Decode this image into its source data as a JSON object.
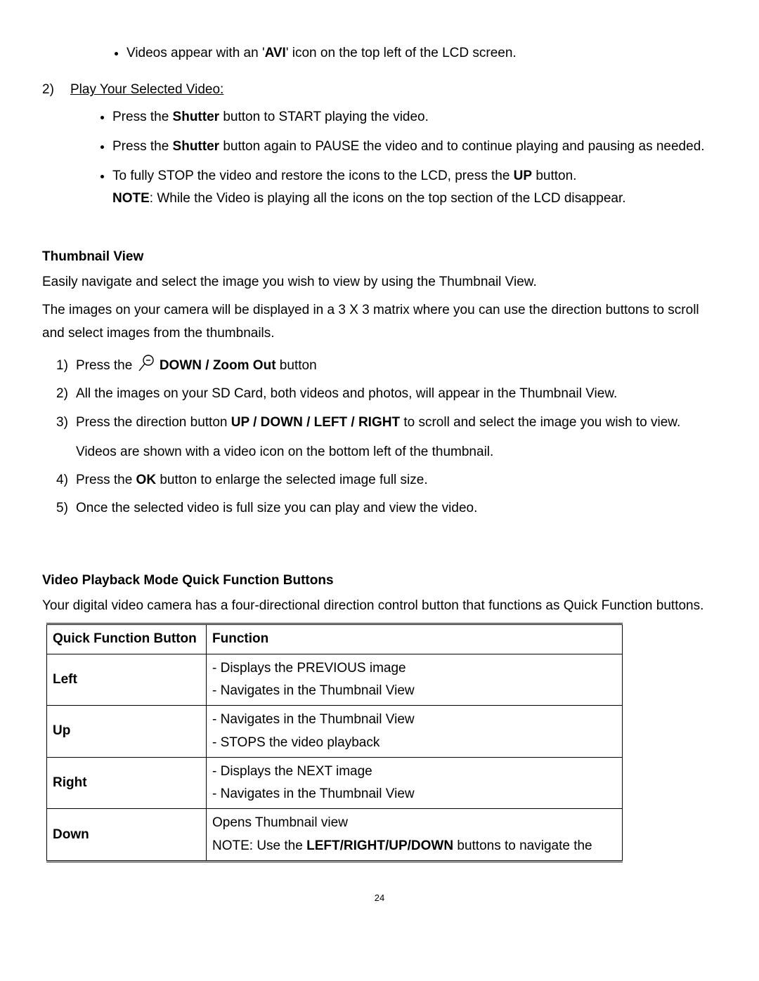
{
  "top_bullet": {
    "pre": "Videos appear with an '",
    "avi": "AVI",
    "post": "' icon on the top left of the LCD screen."
  },
  "play_heading_num": "2)",
  "play_heading": "Play Your Selected Video:",
  "play_bullets": {
    "b1_pre": "Press the ",
    "b1_bold": "Shutter",
    "b1_post": " button to START playing the video.",
    "b2_pre": "Press the ",
    "b2_bold": "Shutter",
    "b2_post": " button again to PAUSE the video and to continue playing and pausing as needed.",
    "b3_pre": "To fully STOP the video and restore the icons to the LCD, press the ",
    "b3_bold": "UP",
    "b3_post": " button.",
    "b3_note_label": "NOTE",
    "b3_note_rest": ": While the Video is playing all the icons on the top section of the LCD disappear."
  },
  "thumb_heading": "Thumbnail View",
  "thumb_p1": "Easily navigate and select the image you wish to view by using the Thumbnail View.",
  "thumb_p2": "The images on your camera will be displayed in a 3 X 3 matrix where you can use the direction buttons to scroll and select images from the thumbnails.",
  "thumb_steps": {
    "s1_num": "1)",
    "s1_pre": "Press the ",
    "s1_bold": "DOWN / Zoom Out",
    "s1_post": " button",
    "s2_num": "2)",
    "s2": "All the images on your SD Card, both videos and photos, will appear in the Thumbnail View.",
    "s3_num": "3)",
    "s3_pre": "Press the direction button ",
    "s3_bold": "UP / DOWN / LEFT / RIGHT",
    "s3_post": " to scroll and select the image you wish to view.",
    "s3_sub": "Videos are shown with a video icon on the bottom left of the thumbnail.",
    "s4_num": "4)",
    "s4_pre": "Press the ",
    "s4_bold": "OK",
    "s4_post": " button to enlarge the selected image full size.",
    "s5_num": "5)",
    "s5": "Once the selected video is full size you can play and view the video."
  },
  "vpb_heading": "Video Playback Mode Quick Function Buttons",
  "vpb_intro": "Your digital video camera has a four-directional direction control button that functions as Quick Function buttons.",
  "table": {
    "h1": "Quick Function Button",
    "h2": "Function",
    "rows": [
      {
        "btn": "Left",
        "f1": "- Displays the PREVIOUS image",
        "f2": "- Navigates in the Thumbnail View"
      },
      {
        "btn": "Up",
        "f1": "- Navigates in the Thumbnail View",
        "f2": "- STOPS the video playback"
      },
      {
        "btn": "Right",
        "f1": "- Displays the NEXT image",
        "f2": "- Navigates in the Thumbnail View"
      }
    ],
    "down_btn": "Down",
    "down_f1": "Opens Thumbnail view",
    "down_note_pre": "NOTE: Use the ",
    "down_note_bold": "LEFT/RIGHT/UP/DOWN",
    "down_note_post": " buttons to navigate the"
  },
  "page_number": "24"
}
